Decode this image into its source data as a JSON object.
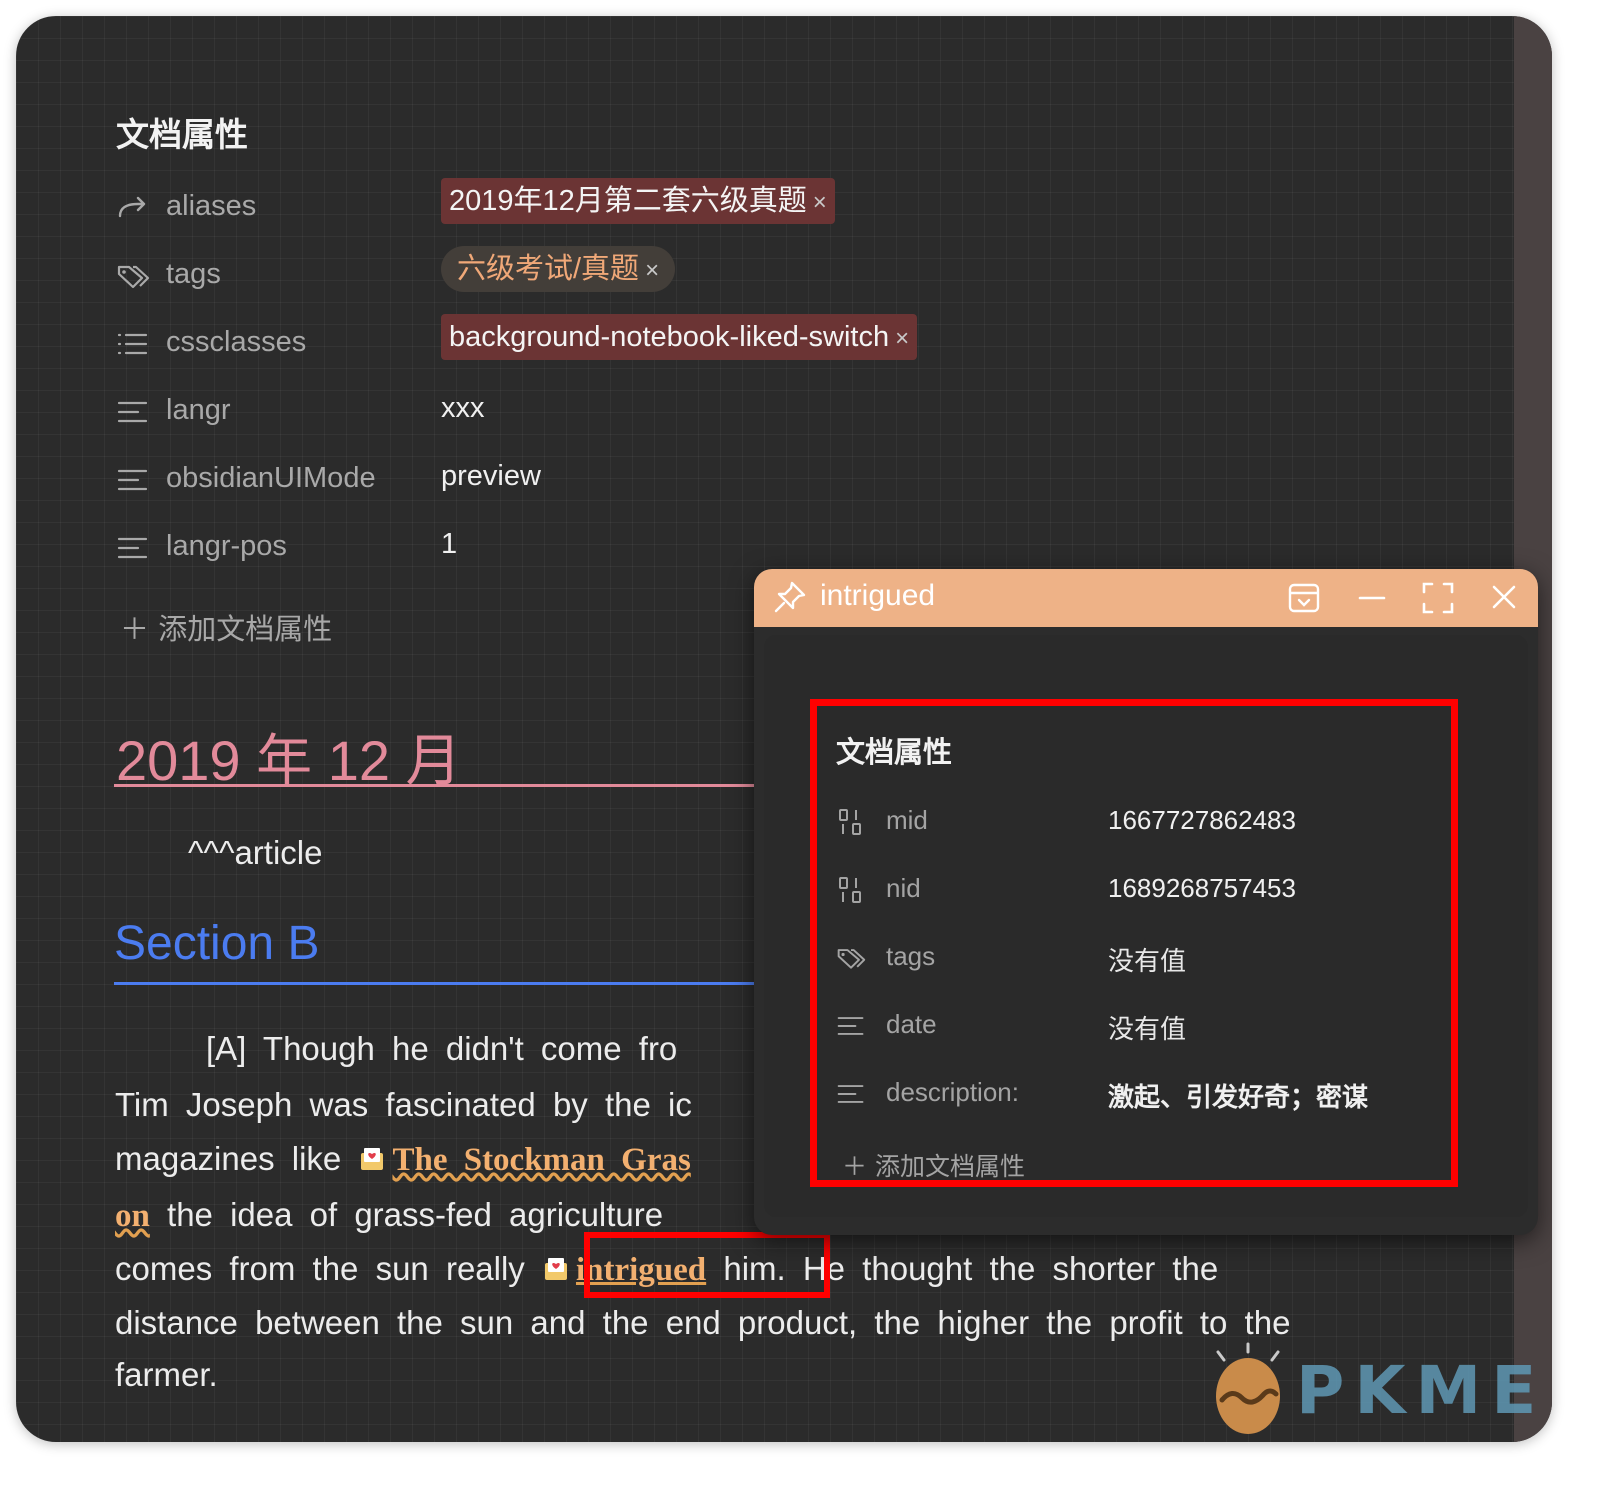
{
  "main": {
    "properties_title": "文档属性",
    "properties": [
      {
        "key": "aliases",
        "icon": "forward-arrow-icon",
        "type": "pill-alias",
        "value": "2019年12月第二套六级真题"
      },
      {
        "key": "tags",
        "icon": "tags-icon",
        "type": "pill-tag",
        "value": "六级考试/真题"
      },
      {
        "key": "cssclasses",
        "icon": "list-icon",
        "type": "pill-css",
        "value": "background-notebook-liked-switch"
      },
      {
        "key": "langr",
        "icon": "text-lines-icon",
        "type": "text",
        "value": "xxx"
      },
      {
        "key": "obsidianUIMode",
        "icon": "text-lines-icon",
        "type": "text",
        "value": "preview"
      },
      {
        "key": "langr-pos",
        "icon": "text-lines-icon",
        "type": "text",
        "value": "1"
      }
    ],
    "remove_symbol": "×",
    "add_property": "＋ 添加文档属性",
    "heading1": "2019 年 12 月",
    "article_tag": "^^^article",
    "heading2": "Section B",
    "paragraph": {
      "line1": "[A] Though he didn't come fro",
      "line2": "Tim Joseph was fascinated by the ic",
      "line3_pre": "magazines like ",
      "line3_link": "The Stockman Gras",
      "line4_link": "on",
      "line4_post": " the idea of grass-fed agriculture",
      "line5_pre": "comes from the sun really ",
      "line5_link": "intrigued",
      "line5_post": " him. He thought the shorter the",
      "line6": "distance between the sun and the end product, the higher the profit to the",
      "line7": "farmer."
    }
  },
  "popover": {
    "title": "intrigued",
    "properties_title": "文档属性",
    "properties": [
      {
        "key": "mid",
        "icon": "number-icon",
        "value": "1667727862483"
      },
      {
        "key": "nid",
        "icon": "number-icon",
        "value": "1689268757453"
      },
      {
        "key": "tags",
        "icon": "tags-icon",
        "value": "没有值"
      },
      {
        "key": "date",
        "icon": "text-lines-icon",
        "value": "没有值"
      },
      {
        "key": "description:",
        "icon": "text-lines-icon",
        "value": "激起、引发好奇；密谋"
      }
    ],
    "add_property": "＋ 添加文档属性"
  },
  "watermark": {
    "text": "PKMER"
  },
  "colors": {
    "background": "#2b2b2b",
    "popover_header": "#eeb287",
    "heading1": "#e28a9a",
    "heading2": "#4b7cf0",
    "link": "#f3b070",
    "highlight_box": "#ff0000",
    "alias_pill": "#6b3434"
  }
}
